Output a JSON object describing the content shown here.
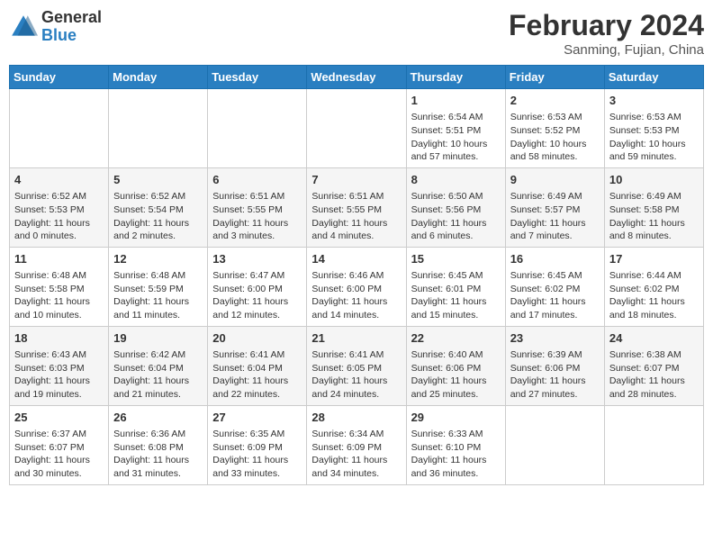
{
  "header": {
    "logo_general": "General",
    "logo_blue": "Blue",
    "title": "February 2024",
    "location": "Sanming, Fujian, China"
  },
  "days_of_week": [
    "Sunday",
    "Monday",
    "Tuesday",
    "Wednesday",
    "Thursday",
    "Friday",
    "Saturday"
  ],
  "weeks": [
    [
      {
        "day": "",
        "info": ""
      },
      {
        "day": "",
        "info": ""
      },
      {
        "day": "",
        "info": ""
      },
      {
        "day": "",
        "info": ""
      },
      {
        "day": "1",
        "info": "Sunrise: 6:54 AM\nSunset: 5:51 PM\nDaylight: 10 hours and 57 minutes."
      },
      {
        "day": "2",
        "info": "Sunrise: 6:53 AM\nSunset: 5:52 PM\nDaylight: 10 hours and 58 minutes."
      },
      {
        "day": "3",
        "info": "Sunrise: 6:53 AM\nSunset: 5:53 PM\nDaylight: 10 hours and 59 minutes."
      }
    ],
    [
      {
        "day": "4",
        "info": "Sunrise: 6:52 AM\nSunset: 5:53 PM\nDaylight: 11 hours and 0 minutes."
      },
      {
        "day": "5",
        "info": "Sunrise: 6:52 AM\nSunset: 5:54 PM\nDaylight: 11 hours and 2 minutes."
      },
      {
        "day": "6",
        "info": "Sunrise: 6:51 AM\nSunset: 5:55 PM\nDaylight: 11 hours and 3 minutes."
      },
      {
        "day": "7",
        "info": "Sunrise: 6:51 AM\nSunset: 5:55 PM\nDaylight: 11 hours and 4 minutes."
      },
      {
        "day": "8",
        "info": "Sunrise: 6:50 AM\nSunset: 5:56 PM\nDaylight: 11 hours and 6 minutes."
      },
      {
        "day": "9",
        "info": "Sunrise: 6:49 AM\nSunset: 5:57 PM\nDaylight: 11 hours and 7 minutes."
      },
      {
        "day": "10",
        "info": "Sunrise: 6:49 AM\nSunset: 5:58 PM\nDaylight: 11 hours and 8 minutes."
      }
    ],
    [
      {
        "day": "11",
        "info": "Sunrise: 6:48 AM\nSunset: 5:58 PM\nDaylight: 11 hours and 10 minutes."
      },
      {
        "day": "12",
        "info": "Sunrise: 6:48 AM\nSunset: 5:59 PM\nDaylight: 11 hours and 11 minutes."
      },
      {
        "day": "13",
        "info": "Sunrise: 6:47 AM\nSunset: 6:00 PM\nDaylight: 11 hours and 12 minutes."
      },
      {
        "day": "14",
        "info": "Sunrise: 6:46 AM\nSunset: 6:00 PM\nDaylight: 11 hours and 14 minutes."
      },
      {
        "day": "15",
        "info": "Sunrise: 6:45 AM\nSunset: 6:01 PM\nDaylight: 11 hours and 15 minutes."
      },
      {
        "day": "16",
        "info": "Sunrise: 6:45 AM\nSunset: 6:02 PM\nDaylight: 11 hours and 17 minutes."
      },
      {
        "day": "17",
        "info": "Sunrise: 6:44 AM\nSunset: 6:02 PM\nDaylight: 11 hours and 18 minutes."
      }
    ],
    [
      {
        "day": "18",
        "info": "Sunrise: 6:43 AM\nSunset: 6:03 PM\nDaylight: 11 hours and 19 minutes."
      },
      {
        "day": "19",
        "info": "Sunrise: 6:42 AM\nSunset: 6:04 PM\nDaylight: 11 hours and 21 minutes."
      },
      {
        "day": "20",
        "info": "Sunrise: 6:41 AM\nSunset: 6:04 PM\nDaylight: 11 hours and 22 minutes."
      },
      {
        "day": "21",
        "info": "Sunrise: 6:41 AM\nSunset: 6:05 PM\nDaylight: 11 hours and 24 minutes."
      },
      {
        "day": "22",
        "info": "Sunrise: 6:40 AM\nSunset: 6:06 PM\nDaylight: 11 hours and 25 minutes."
      },
      {
        "day": "23",
        "info": "Sunrise: 6:39 AM\nSunset: 6:06 PM\nDaylight: 11 hours and 27 minutes."
      },
      {
        "day": "24",
        "info": "Sunrise: 6:38 AM\nSunset: 6:07 PM\nDaylight: 11 hours and 28 minutes."
      }
    ],
    [
      {
        "day": "25",
        "info": "Sunrise: 6:37 AM\nSunset: 6:07 PM\nDaylight: 11 hours and 30 minutes."
      },
      {
        "day": "26",
        "info": "Sunrise: 6:36 AM\nSunset: 6:08 PM\nDaylight: 11 hours and 31 minutes."
      },
      {
        "day": "27",
        "info": "Sunrise: 6:35 AM\nSunset: 6:09 PM\nDaylight: 11 hours and 33 minutes."
      },
      {
        "day": "28",
        "info": "Sunrise: 6:34 AM\nSunset: 6:09 PM\nDaylight: 11 hours and 34 minutes."
      },
      {
        "day": "29",
        "info": "Sunrise: 6:33 AM\nSunset: 6:10 PM\nDaylight: 11 hours and 36 minutes."
      },
      {
        "day": "",
        "info": ""
      },
      {
        "day": "",
        "info": ""
      }
    ]
  ]
}
